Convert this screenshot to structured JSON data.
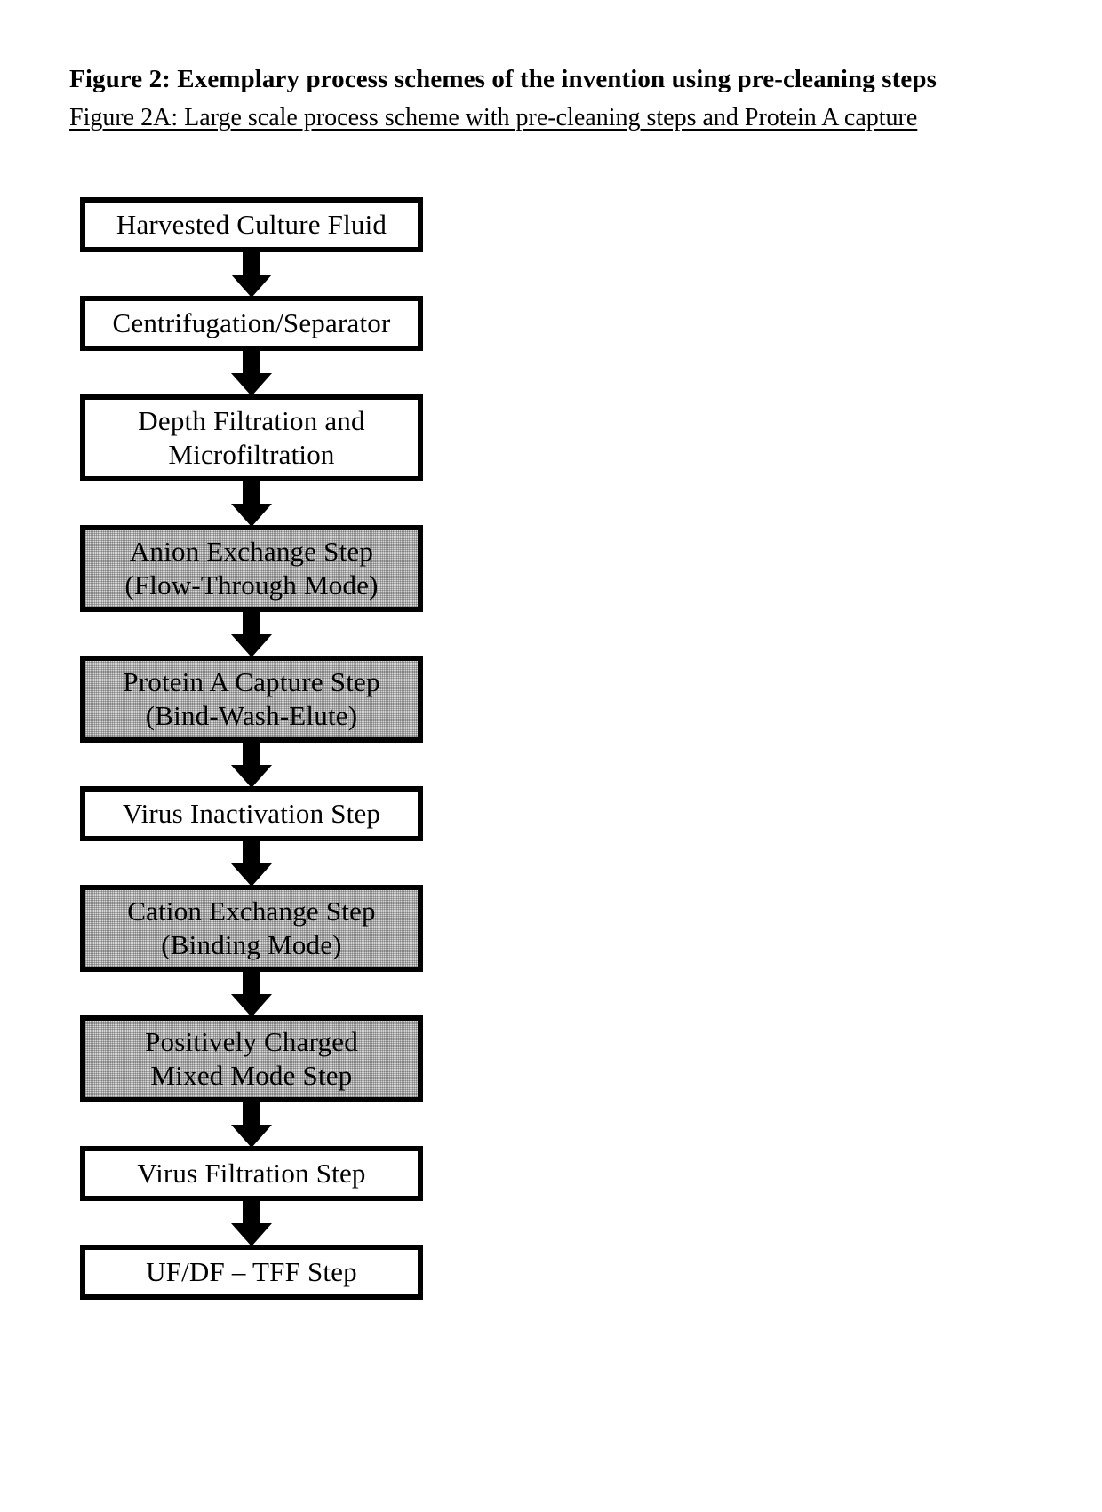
{
  "figure": {
    "title": "Figure 2:  Exemplary process schemes of the invention using pre-cleaning steps",
    "subtitle": "Figure 2A: Large scale process scheme with pre-cleaning steps and Protein A capture"
  },
  "colors": {
    "stroke": "#000000",
    "plain_fill": "#ffffff",
    "shaded_fill": "#d6d6d6",
    "page_background": "#ffffff"
  },
  "diagram": {
    "type": "flowchart",
    "orientation": "top-to-bottom",
    "connector": "solid-block-down-arrow",
    "nodes": [
      {
        "id": "harvested-culture-fluid",
        "label": "Harvested Culture Fluid",
        "shaded": false,
        "lines": 1
      },
      {
        "id": "centrifugation-separator",
        "label": "Centrifugation/Separator",
        "shaded": false,
        "lines": 1
      },
      {
        "id": "depth-microfiltration",
        "label": "Depth Filtration and\nMicrofiltration",
        "shaded": false,
        "lines": 2
      },
      {
        "id": "anion-exchange-step",
        "label": "Anion Exchange Step\n(Flow-Through Mode)",
        "shaded": true,
        "lines": 2
      },
      {
        "id": "protein-a-capture-step",
        "label": "Protein A Capture Step\n(Bind-Wash-Elute)",
        "shaded": true,
        "lines": 2
      },
      {
        "id": "virus-inactivation-step",
        "label": "Virus Inactivation Step",
        "shaded": false,
        "lines": 1
      },
      {
        "id": "cation-exchange-step",
        "label": "Cation Exchange Step\n(Binding Mode)",
        "shaded": true,
        "lines": 2
      },
      {
        "id": "positively-charged-mixed-mode-step",
        "label": "Positively Charged\nMixed Mode Step",
        "shaded": true,
        "lines": 2
      },
      {
        "id": "virus-filtration-step",
        "label": "Virus Filtration Step",
        "shaded": false,
        "lines": 1
      },
      {
        "id": "uf-df-tff-step",
        "label": "UF/DF – TFF Step",
        "shaded": false,
        "lines": 1
      }
    ],
    "edges": [
      {
        "from": "harvested-culture-fluid",
        "to": "centrifugation-separator"
      },
      {
        "from": "centrifugation-separator",
        "to": "depth-microfiltration"
      },
      {
        "from": "depth-microfiltration",
        "to": "anion-exchange-step"
      },
      {
        "from": "anion-exchange-step",
        "to": "protein-a-capture-step"
      },
      {
        "from": "protein-a-capture-step",
        "to": "virus-inactivation-step"
      },
      {
        "from": "virus-inactivation-step",
        "to": "cation-exchange-step"
      },
      {
        "from": "cation-exchange-step",
        "to": "positively-charged-mixed-mode-step"
      },
      {
        "from": "positively-charged-mixed-mode-step",
        "to": "virus-filtration-step"
      },
      {
        "from": "virus-filtration-step",
        "to": "uf-df-tff-step"
      }
    ]
  }
}
